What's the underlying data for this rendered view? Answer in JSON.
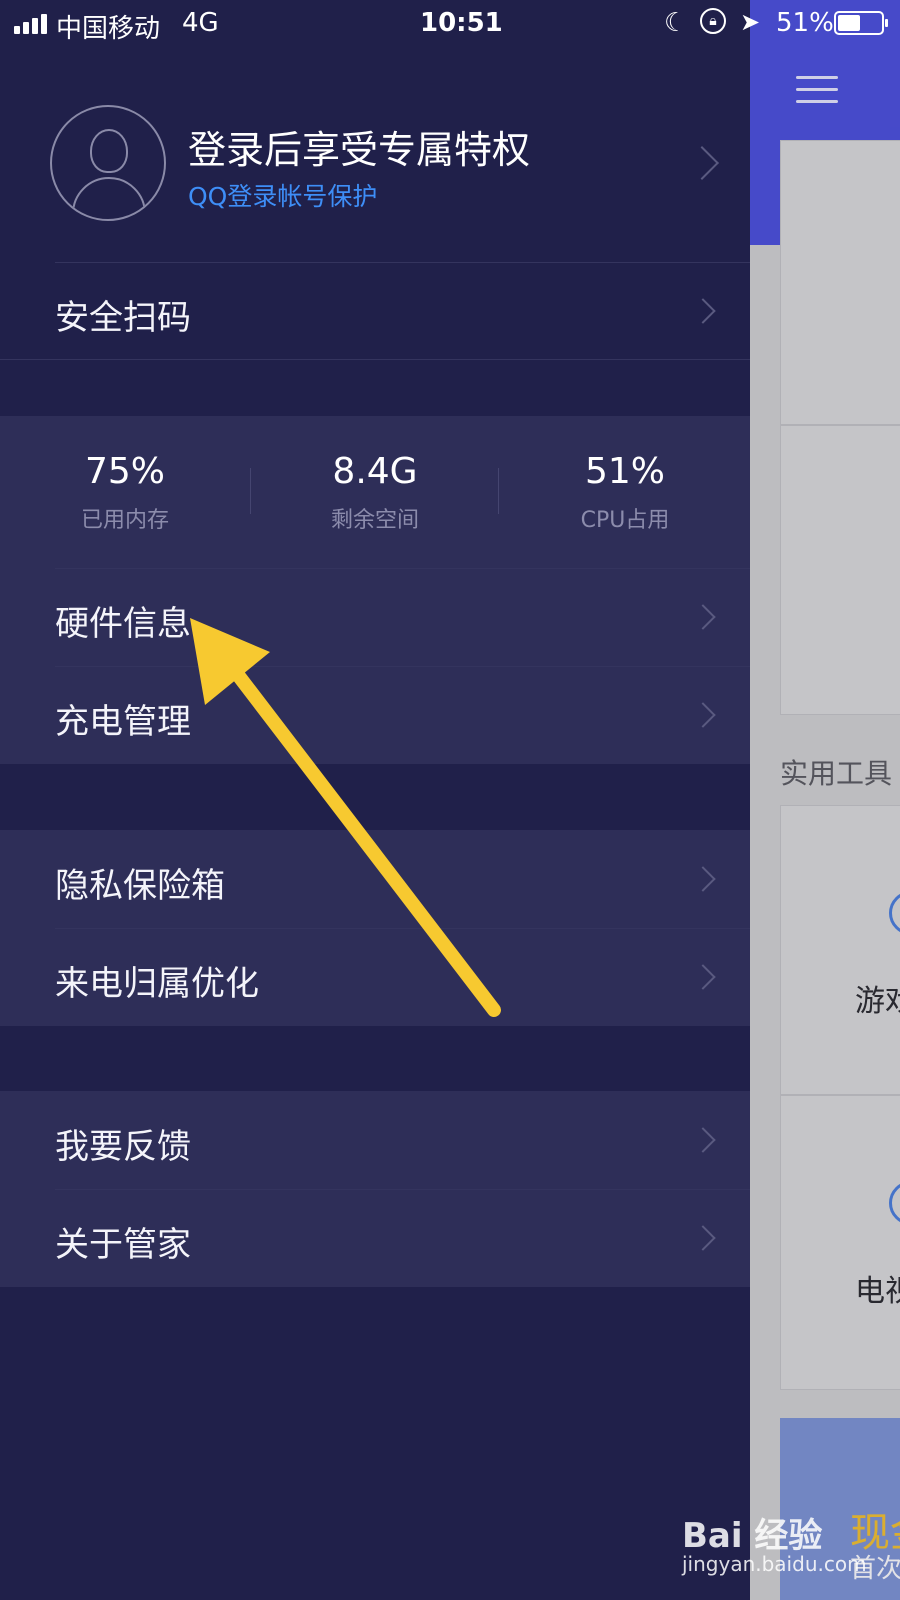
{
  "status_bar": {
    "carrier": "中国移动",
    "network": "4G",
    "time": "10:51",
    "battery": "51%"
  },
  "profile": {
    "title": "登录后享受专属特权",
    "subtitle": "QQ登录帐号保护"
  },
  "menu": {
    "scan": "安全扫码",
    "hardware": "硬件信息",
    "charging": "充电管理",
    "privacy_vault": "隐私保险箱",
    "caller_id": "来电归属优化",
    "feedback": "我要反馈",
    "about": "关于管家"
  },
  "stats": [
    {
      "value": "75%",
      "label": "已用内存"
    },
    {
      "value": "8.4G",
      "label": "剩余空间"
    },
    {
      "value": "51%",
      "label": "CPU占用"
    }
  ],
  "background_page": {
    "tools_title": "实用工具",
    "tool_1": "游戏",
    "tool_2": "电视",
    "banner_line_1": "现金",
    "banner_line_2": "首次"
  },
  "watermark": {
    "logo": "Bai 经验",
    "url": "jingyan.baidu.com"
  },
  "colors": {
    "drawer_bg": "#20204a",
    "group_bg": "#2e2e58",
    "link_blue": "#3e8ef7",
    "header_blue": "#4b4fd6",
    "arrow_yellow": "#f7c930"
  }
}
